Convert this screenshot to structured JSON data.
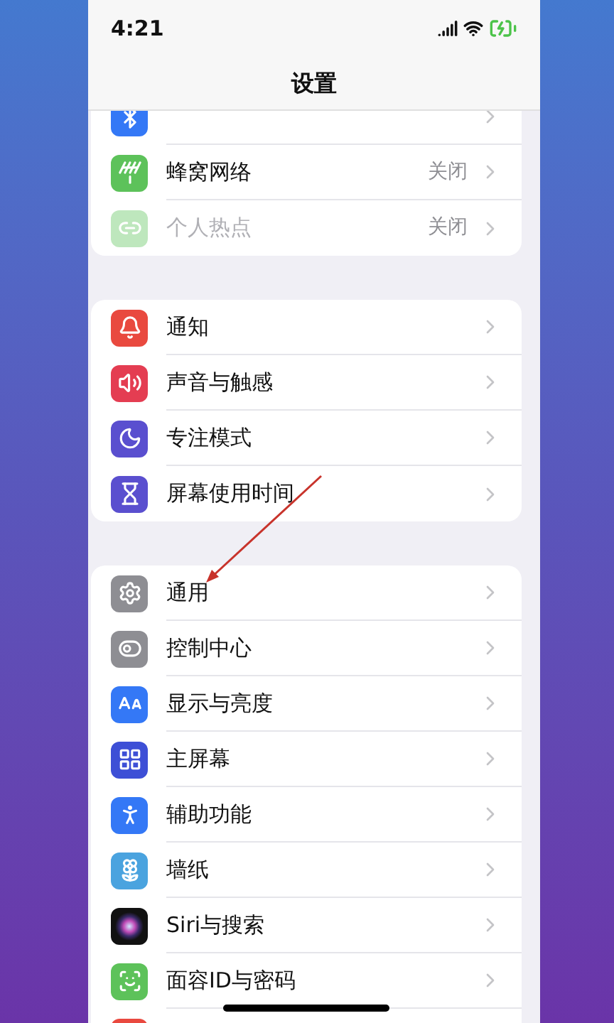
{
  "status_bar": {
    "time": "4:21"
  },
  "nav": {
    "title": "设置"
  },
  "groups": [
    {
      "items": [
        {
          "disabled": false
        },
        {
          "label": "蜂窝网络",
          "value": "关闭",
          "disabled": false
        },
        {
          "label": "个人热点",
          "value": "关闭",
          "disabled": true
        }
      ]
    },
    {
      "items": [
        {
          "label": "通知",
          "disabled": false
        },
        {
          "label": "声音与触感",
          "disabled": false
        },
        {
          "label": "专注模式",
          "disabled": false
        },
        {
          "label": "屏幕使用时间",
          "disabled": false
        }
      ]
    },
    {
      "items": [
        {
          "label": "通用",
          "disabled": false
        },
        {
          "label": "控制中心",
          "disabled": false
        },
        {
          "label": "显示与亮度",
          "disabled": false
        },
        {
          "label": "主屏幕",
          "disabled": false
        },
        {
          "label": "辅助功能",
          "disabled": false
        },
        {
          "label": "墙纸",
          "disabled": false
        },
        {
          "label": "Siri与搜索",
          "disabled": false
        },
        {
          "label": "面容ID与密码",
          "disabled": false
        },
        {
          "disabled": false
        }
      ]
    }
  ]
}
